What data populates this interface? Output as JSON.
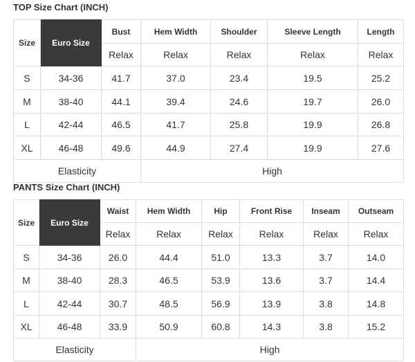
{
  "top": {
    "title": "TOP Size Chart (INCH)",
    "size_label": "Size",
    "euro_label": "Euro Size",
    "measures": [
      "Bust",
      "Hem Width",
      "Shoulder",
      "Sleeve Length",
      "Length"
    ],
    "relax": "Relax",
    "rows": [
      [
        "S",
        "34-36",
        "41.7",
        "37.0",
        "23.4",
        "19.5",
        "25.2"
      ],
      [
        "M",
        "38-40",
        "44.1",
        "39.4",
        "24.6",
        "19.7",
        "26.0"
      ],
      [
        "L",
        "42-44",
        "46.5",
        "41.7",
        "25.8",
        "19.9",
        "26.8"
      ],
      [
        "XL",
        "46-48",
        "49.6",
        "44.9",
        "27.4",
        "19.9",
        "27.6"
      ]
    ],
    "elasticity_label": "Elasticity",
    "elasticity_value": "High"
  },
  "pants": {
    "title": "PANTS Size Chart (INCH)",
    "size_label": "Size",
    "euro_label": "Euro Size",
    "measures": [
      "Waist",
      "Hem Width",
      "Hip",
      "Front Rise",
      "Inseam",
      "Outseam"
    ],
    "relax": "Relax",
    "rows": [
      [
        "S",
        "34-36",
        "26.0",
        "44.4",
        "51.0",
        "13.3",
        "3.7",
        "14.0"
      ],
      [
        "M",
        "38-40",
        "28.3",
        "46.5",
        "53.9",
        "13.6",
        "3.7",
        "14.4"
      ],
      [
        "L",
        "42-44",
        "30.7",
        "48.5",
        "56.9",
        "13.9",
        "3.8",
        "14.8"
      ],
      [
        "XL",
        "46-48",
        "33.9",
        "50.9",
        "60.8",
        "14.3",
        "3.8",
        "15.2"
      ]
    ],
    "elasticity_label": "Elasticity",
    "elasticity_value": "High"
  }
}
